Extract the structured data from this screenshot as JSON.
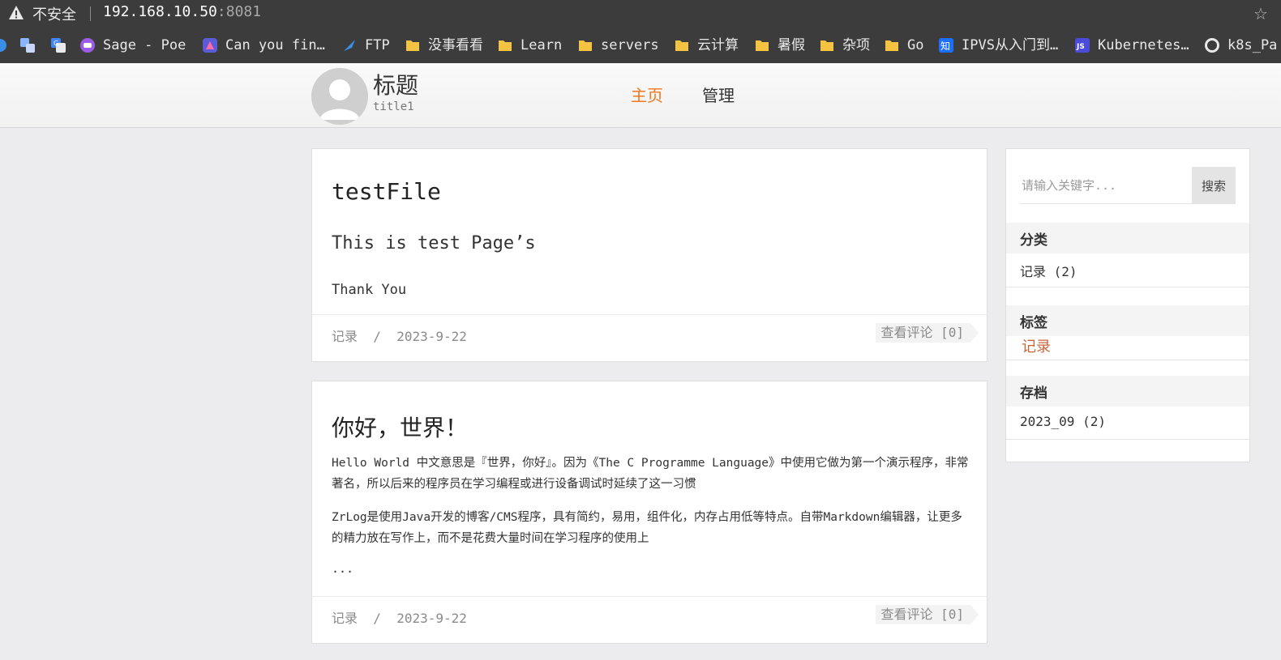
{
  "browser": {
    "security_label": "不安全",
    "url_host": "192.168.10.50",
    "url_port": ":8081",
    "bookmarks": [
      {
        "label": "Sage - Poe",
        "icon": "poe-icon",
        "color": "#9b5de5"
      },
      {
        "label": "Can you fin…",
        "icon": "app-icon",
        "color": "#5b5bd6"
      },
      {
        "label": "FTP",
        "icon": "ftp-icon",
        "color": "#3a8ee6"
      },
      {
        "label": "没事看看",
        "icon": "folder-icon",
        "color": "#f5c342"
      },
      {
        "label": "Learn",
        "icon": "folder-icon",
        "color": "#f5c342"
      },
      {
        "label": "servers",
        "icon": "folder-icon",
        "color": "#f5c342"
      },
      {
        "label": "云计算",
        "icon": "folder-icon",
        "color": "#f5c342"
      },
      {
        "label": "暑假",
        "icon": "folder-icon",
        "color": "#f5c342"
      },
      {
        "label": "杂项",
        "icon": "folder-icon",
        "color": "#f5c342"
      },
      {
        "label": "Go",
        "icon": "folder-icon",
        "color": "#f5c342"
      },
      {
        "label": "IPVS从入门到…",
        "icon": "zhihu-icon",
        "color": "#1e6fff"
      },
      {
        "label": "Kubernetes…",
        "icon": "js-icon",
        "color": "#4b4bd9"
      },
      {
        "label": "k8s_Pa",
        "icon": "github-icon",
        "color": "#1a1a1a"
      }
    ]
  },
  "site": {
    "title": "标题",
    "subtitle": "title1",
    "nav": [
      {
        "label": "主页",
        "active": true
      },
      {
        "label": "管理",
        "active": false
      }
    ]
  },
  "posts": [
    {
      "title": "testFile",
      "subheading": "This is test Page’s",
      "body": [
        "Thank You"
      ],
      "category": "记录",
      "separator": "/",
      "date": "2023-9-22",
      "comments_label": "查看评论 [0]"
    },
    {
      "title": "你好，世界！",
      "body": [
        "Hello World 中文意思是『世界，你好』。因为《The C Programme Language》中使用它做为第一个演示程序，非常著名，所以后来的程序员在学习编程或进行设备调试时延续了这一习惯",
        "ZrLog是使用Java开发的博客/CMS程序，具有简约，易用，组件化，内存占用低等特点。自带Markdown编辑器，让更多的精力放在写作上，而不是花费大量时间在学习程序的使用上",
        "..."
      ],
      "category": "记录",
      "separator": "/",
      "date": "2023-9-22",
      "comments_label": "查看评论 [0]"
    }
  ],
  "sidebar": {
    "search_placeholder": "请输入关键字...",
    "search_button": "搜索",
    "categories_heading": "分类",
    "categories": [
      "记录 (2)"
    ],
    "tags_heading": "标签",
    "tags": [
      "记录"
    ],
    "archives_heading": "存档",
    "archives": [
      "2023_09 (2)"
    ]
  },
  "colors": {
    "accent": "#f07820",
    "tag": "#c8663a",
    "chrome": "#3c3c3c"
  }
}
